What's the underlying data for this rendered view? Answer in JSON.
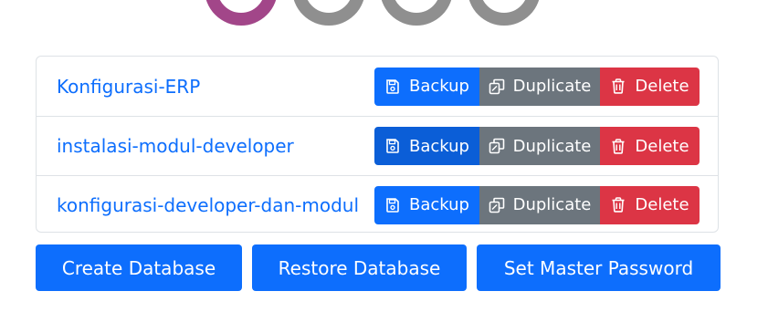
{
  "logo": {
    "colors": [
      "#a24689",
      "#8f8f8f",
      "#8f8f8f",
      "#8f8f8f"
    ]
  },
  "databases": [
    {
      "name": "Konfigurasi-ERP",
      "backup_label": "Backup",
      "duplicate_label": "Duplicate",
      "delete_label": "Delete"
    },
    {
      "name": "instalasi-modul-developer",
      "backup_label": "Backup",
      "duplicate_label": "Duplicate",
      "delete_label": "Delete"
    },
    {
      "name": "konfigurasi-developer-dan-modul",
      "backup_label": "Backup",
      "duplicate_label": "Duplicate",
      "delete_label": "Delete"
    }
  ],
  "actions": {
    "create_label": "Create Database",
    "restore_label": "Restore Database",
    "master_password_label": "Set Master Password"
  },
  "icons": {
    "backup": "floppy-disk-icon",
    "duplicate": "copy-icon",
    "delete": "trash-icon"
  },
  "colors": {
    "primary": "#0d6efd",
    "primary_active": "#0b5ed7",
    "secondary": "#6c757d",
    "danger": "#dc3545"
  }
}
